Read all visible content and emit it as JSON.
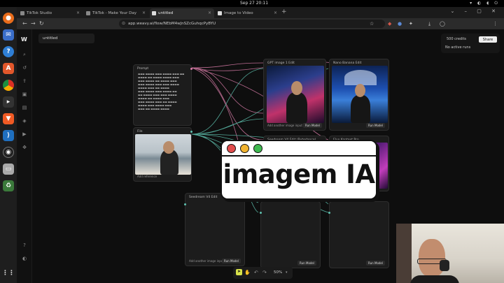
{
  "system": {
    "clock": "Sep 27  20:11"
  },
  "browser": {
    "tabs": [
      {
        "label": "TikTok Studio"
      },
      {
        "label": "TikTok - Make Your Day"
      },
      {
        "label": "untitled"
      },
      {
        "label": "Image to Video"
      }
    ],
    "url": "app.weavy.ai/flow/NEbM4wJnSZcGuhqcPyBYU"
  },
  "app": {
    "file_name": "untitled",
    "credits": "500 credits",
    "share_label": "Share",
    "runs_label": "No active runs",
    "zoom": "50%"
  },
  "nodes": {
    "prompt": {
      "label": "Prompt"
    },
    "file": {
      "label": "File",
      "foot": "Add reference"
    },
    "img1": {
      "label": "GPT image 1 Edit",
      "foot": "Add another image input",
      "run": "Run Model"
    },
    "img2": {
      "label": "Nano Banana Edit",
      "run": "Run Model"
    },
    "img3": {
      "label": "Seedream V4 Edit (Bytedance)"
    },
    "img4": {
      "label": "Flux Kontext Pro"
    },
    "out1": {
      "label": "Seedream V4 Edit",
      "foot": "Add another image input",
      "run": "Run Model"
    },
    "out2": {
      "run": "Run Model"
    },
    "out3": {
      "run": "Run Model"
    }
  },
  "overlay": {
    "title": "imagem IA",
    "colors": {
      "red": "#e24c4c",
      "yellow": "#f2b431",
      "green": "#3fb950"
    }
  }
}
